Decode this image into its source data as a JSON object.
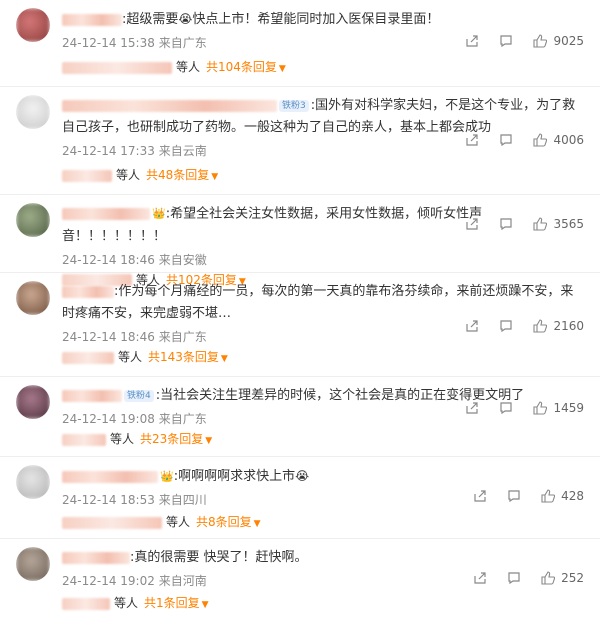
{
  "colors": {
    "link": "#ff8200",
    "meta": "#8a8a8a",
    "text": "#333333"
  },
  "icons": {
    "share": "share-icon",
    "comment": "comment-icon",
    "like": "thumbs-up-icon"
  },
  "comments": [
    {
      "body": ":超级需要",
      "emoji": "😭",
      "body2": "快点上市！希望能同时加入医保目录里面！",
      "time": "24-12-14 15:38",
      "location": "来自广东",
      "likes": "9025",
      "others": "等人",
      "replies": "共104条回复"
    },
    {
      "badge": "铁粉3",
      "body": ":国外有对科学家夫妇，不是这个专业，为了救自己孩子，也研制成功了药物。一般这种为了自己的亲人，基本上都会成功",
      "time": "24-12-14 17:33",
      "location": "来自云南",
      "likes": "4006",
      "others": "等人",
      "replies": "共48条回复"
    },
    {
      "crown": "👑",
      "body": ":希望全社会关注女性数据，采用女性数据，倾听女性声音！！！！！！！",
      "time": "24-12-14 18:46",
      "location": "来自安徽",
      "likes": "3565",
      "others": "等人",
      "replies": "共102条回复"
    },
    {
      "body": ":作为每个月痛经的一员，每次的第一天真的靠布洛芬续命，来前还烦躁不安，来时疼痛不安，来完虚弱不堪…",
      "time": "24-12-14 18:46",
      "location": "来自广东",
      "likes": "2160",
      "others": "等人",
      "replies": "共143条回复"
    },
    {
      "badge": "铁粉4",
      "body": ":当社会关注生理差异的时候，这个社会是真的正在变得更文明了",
      "time": "24-12-14 19:08",
      "location": "来自广东",
      "likes": "1459",
      "others": "等人",
      "replies": "共23条回复"
    },
    {
      "crown": "👑",
      "body": ":啊啊啊啊求求快上市",
      "emoji": "😭",
      "time": "24-12-14 18:53",
      "location": "来自四川",
      "likes": "428",
      "others": "等人",
      "replies": "共8条回复"
    },
    {
      "body": ":真的很需要 快哭了！赶快啊。",
      "time": "24-12-14 19:02",
      "location": "来自河南",
      "likes": "252",
      "others": "等人",
      "replies": "共1条回复"
    }
  ]
}
